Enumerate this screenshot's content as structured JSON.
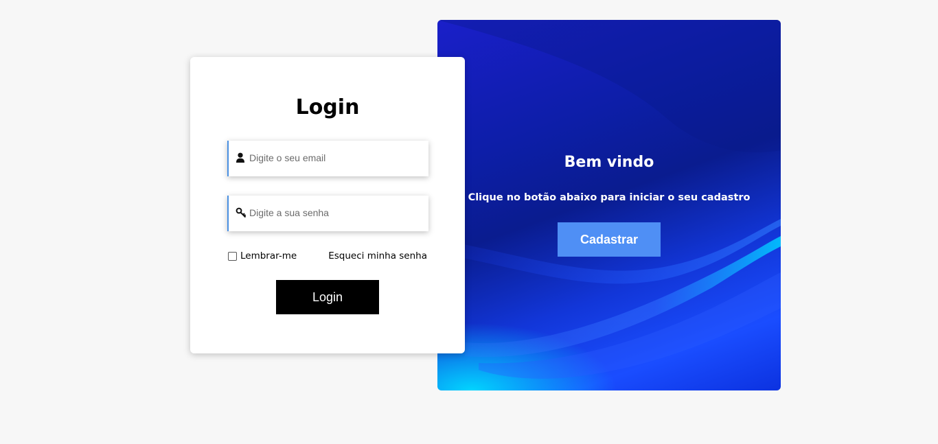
{
  "login": {
    "title": "Login",
    "email_placeholder": "Digite o seu email",
    "password_placeholder": "Digite a sua senha",
    "email_icon": "user-icon",
    "password_icon": "key-icon",
    "remember_label": "Lembrar-me",
    "remember_checked": false,
    "forgot_link": "Esqueci minha senha",
    "submit_label": "Login"
  },
  "welcome": {
    "title": "Bem vindo",
    "text": "Clique no botão abaixo para iniciar o seu cadastro",
    "register_label": "Cadastrar"
  },
  "colors": {
    "page_background": "#f7f7f7",
    "field_accent": "#4a90e2",
    "login_button": "#000000",
    "register_button": "#4f8ff5",
    "welcome_panel": "#0d1ea8"
  }
}
